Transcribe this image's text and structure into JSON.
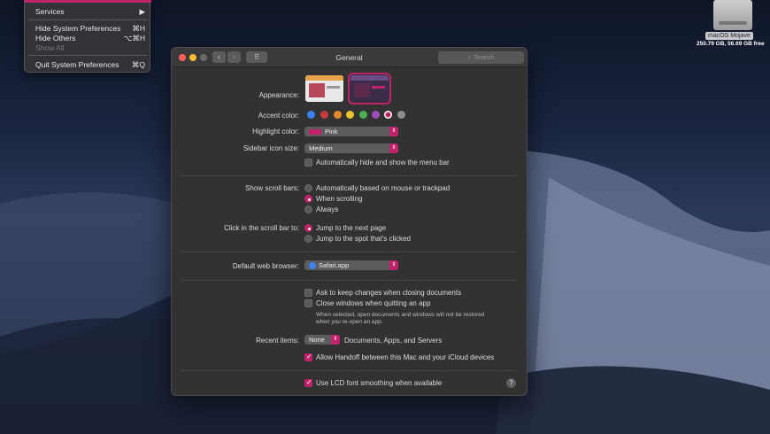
{
  "menu": {
    "items": [
      {
        "label": "Services",
        "shortcut": "▶"
      },
      {
        "label": "Hide System Preferences",
        "shortcut": "⌘H"
      },
      {
        "label": "Hide Others",
        "shortcut": "⌥⌘H"
      },
      {
        "label": "Show All",
        "shortcut": ""
      },
      {
        "label": "Quit System Preferences",
        "shortcut": "⌘Q"
      }
    ]
  },
  "desktop": {
    "drive_label": "macOS Mojave",
    "drive_size": "250.79 GB, 56.69 GB free"
  },
  "window": {
    "title": "General",
    "search_placeholder": "Search",
    "back": "‹",
    "forward": "›",
    "grid": "⠿"
  },
  "settings": {
    "appearance_label": "Appearance:",
    "accent_label": "Accent color:",
    "accent_colors": [
      "#3b82f6",
      "#c53b3b",
      "#e8892a",
      "#e8c52a",
      "#4caf50",
      "#9b4dbd",
      "#c2226b",
      "#8e8e8e"
    ],
    "highlight_label": "Highlight color:",
    "highlight_value": "Pink",
    "sidebar_label": "Sidebar icon size:",
    "sidebar_value": "Medium",
    "menubar_label": "Automatically hide and show the menu bar",
    "scroll_label": "Show scroll bars:",
    "scroll_options": [
      "Automatically based on mouse or trackpad",
      "When scrolling",
      "Always"
    ],
    "click_label": "Click in the scroll bar to:",
    "click_options": [
      "Jump to the next page",
      "Jump to the spot that's clicked"
    ],
    "browser_label": "Default web browser:",
    "browser_value": "Safari.app",
    "ask_label": "Ask to keep changes when closing documents",
    "close_label": "Close windows when quitting an app",
    "close_note_1": "When selected, open documents and windows will not be restored",
    "close_note_2": "when you re-open an app.",
    "recent_label": "Recent items:",
    "recent_value": "None",
    "recent_suffix": "Documents, Apps, and Servers",
    "handoff_label": "Allow Handoff between this Mac and your iCloud devices",
    "lcd_label": "Use LCD font smoothing when available",
    "help": "?"
  }
}
